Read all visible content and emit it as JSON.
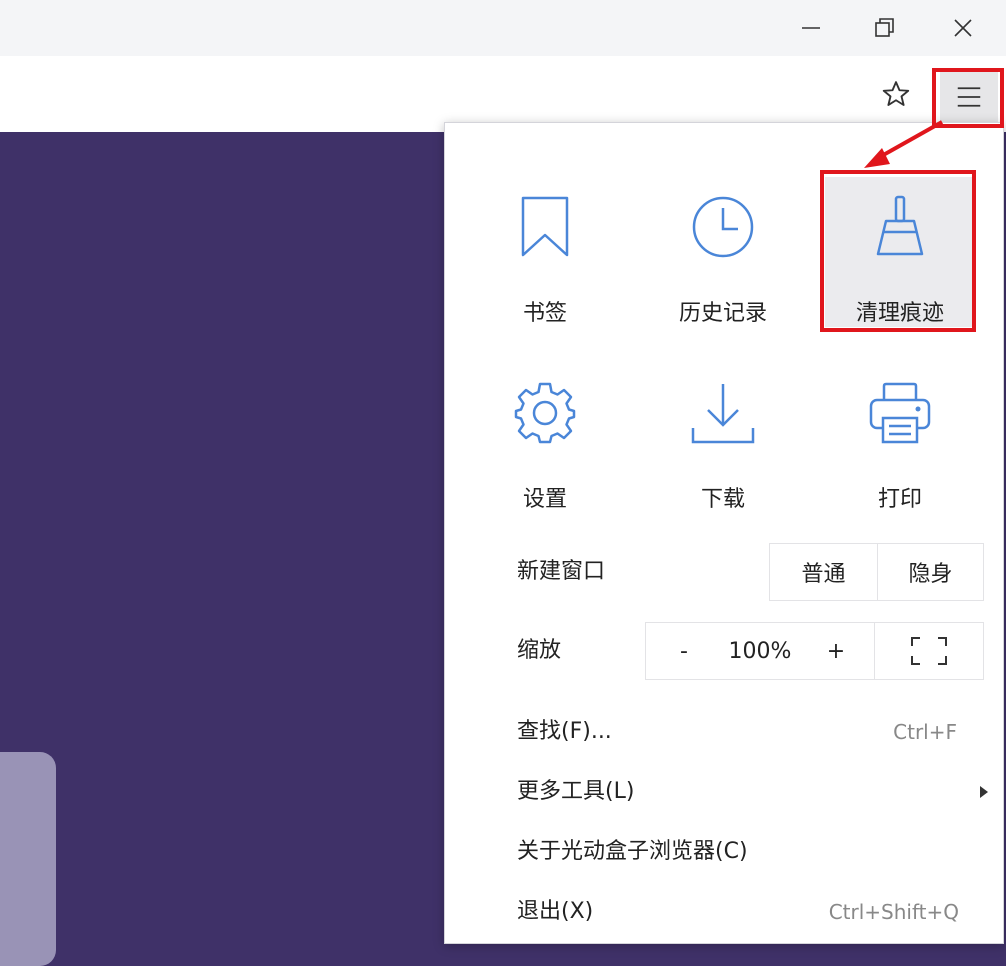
{
  "colors": {
    "accent": "#4a86d8",
    "highlight": "#e0161c",
    "page_bg": "#3f3168"
  },
  "window": {
    "minimize_icon": "minimize-icon",
    "restore_icon": "restore-icon",
    "close_icon": "close-icon"
  },
  "toolbar": {
    "star_icon": "star-icon",
    "menu_icon": "menu-icon"
  },
  "menu": {
    "grid": [
      {
        "label": "书签",
        "icon": "bookmark-icon"
      },
      {
        "label": "历史记录",
        "icon": "history-clock-icon"
      },
      {
        "label": "清理痕迹",
        "icon": "broom-icon"
      },
      {
        "label": "设置",
        "icon": "gear-icon"
      },
      {
        "label": "下载",
        "icon": "download-icon"
      },
      {
        "label": "打印",
        "icon": "printer-icon"
      }
    ],
    "new_window": {
      "label": "新建窗口",
      "normal": "普通",
      "incognito": "隐身"
    },
    "zoom": {
      "label": "缩放",
      "minus": "-",
      "value": "100%",
      "plus": "+",
      "fullscreen_icon": "fullscreen-icon"
    },
    "items": [
      {
        "label": "查找(F)...",
        "shortcut": "Ctrl+F"
      },
      {
        "label": "更多工具(L)",
        "shortcut": ""
      },
      {
        "label": "关于光动盒子浏览器(C)",
        "shortcut": ""
      },
      {
        "label": "退出(X)",
        "shortcut": "Ctrl+Shift+Q"
      }
    ]
  }
}
